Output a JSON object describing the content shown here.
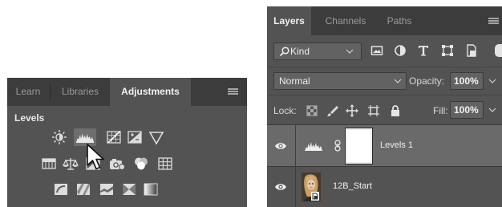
{
  "adjustments_panel": {
    "tabs": [
      {
        "label": "Learn",
        "active": false
      },
      {
        "label": "Libraries",
        "active": false
      },
      {
        "label": "Adjustments",
        "active": true
      }
    ],
    "menu_icon": "hamburger-menu-icon",
    "section_title": "Levels",
    "icon_rows": [
      [
        "brightness-contrast-icon",
        "levels-icon",
        "curves-icon",
        "exposure-icon",
        "vibrance-icon"
      ],
      [
        "hue-saturation-icon",
        "color-balance-icon",
        "black-white-icon",
        "photo-filter-icon",
        "channel-mixer-icon",
        "color-lookup-icon"
      ],
      [
        "invert-icon",
        "posterize-icon",
        "threshold-icon",
        "selective-color-icon",
        "gradient-map-icon"
      ]
    ],
    "hovered_icon": "levels-icon",
    "colors": {
      "panel_bg": "#535353",
      "tab_bar_bg": "#3c3c3c"
    }
  },
  "layers_panel": {
    "tabs": [
      {
        "label": "Layers",
        "active": true
      },
      {
        "label": "Channels",
        "active": false
      },
      {
        "label": "Paths",
        "active": false
      }
    ],
    "menu_icon": "hamburger-menu-icon",
    "filter": {
      "kind_label": "Kind",
      "filter_icons": [
        "pixel-layer-filter-icon",
        "adjustment-layer-filter-icon",
        "type-layer-filter-icon",
        "shape-layer-filter-icon",
        "smart-object-filter-icon"
      ],
      "toggle_on": true
    },
    "blend_mode": "Normal",
    "opacity_label": "Opacity:",
    "opacity_value": "100%",
    "lock_label": "Lock:",
    "lock_icons": [
      "lock-transparent-pixels-icon",
      "lock-image-pixels-icon",
      "lock-position-icon",
      "lock-artboard-icon",
      "lock-all-icon"
    ],
    "fill_label": "Fill:",
    "fill_value": "100%",
    "layers": [
      {
        "name": "Levels 1",
        "type": "adjustment",
        "visible": true,
        "selected": true
      },
      {
        "name": "12B_Start",
        "type": "smart-object",
        "visible": true,
        "selected": false
      }
    ],
    "colors": {
      "selected_row": "#6a6a6a",
      "panel_bg": "#535353"
    }
  },
  "pointer": {
    "icon": "arrow-cursor-icon"
  }
}
